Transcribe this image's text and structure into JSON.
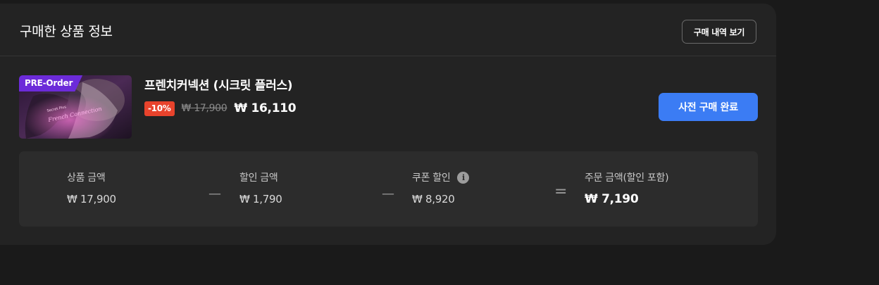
{
  "header": {
    "title": "구매한 상품 정보",
    "history_button": "구매 내역 보기"
  },
  "product": {
    "badge": "PRE-Order",
    "name": "프렌치커넥션 (시크릿 플러스)",
    "discount": "-10%",
    "original_price": "₩ 17,900",
    "final_price": "₩ 16,110",
    "thumbnail_icon": "game-cover-image"
  },
  "actions": {
    "purchase_status": "사전 구매 완료"
  },
  "summary": {
    "product_amount_label": "상품 금액",
    "product_amount_value": "₩ 17,900",
    "discount_amount_label": "할인 금액",
    "discount_amount_value": "₩ 1,790",
    "coupon_discount_label": "쿠폰 할인",
    "coupon_discount_value": "₩ 8,920",
    "order_total_label": "주문 금액(할인 포함)",
    "order_total_value": "₩ 7,190",
    "minus_1": "—",
    "minus_2": "—",
    "equals": "="
  },
  "colors": {
    "accent": "#3b7cf4",
    "preorder": "#6c2bd9",
    "discount": "#e8432c"
  }
}
